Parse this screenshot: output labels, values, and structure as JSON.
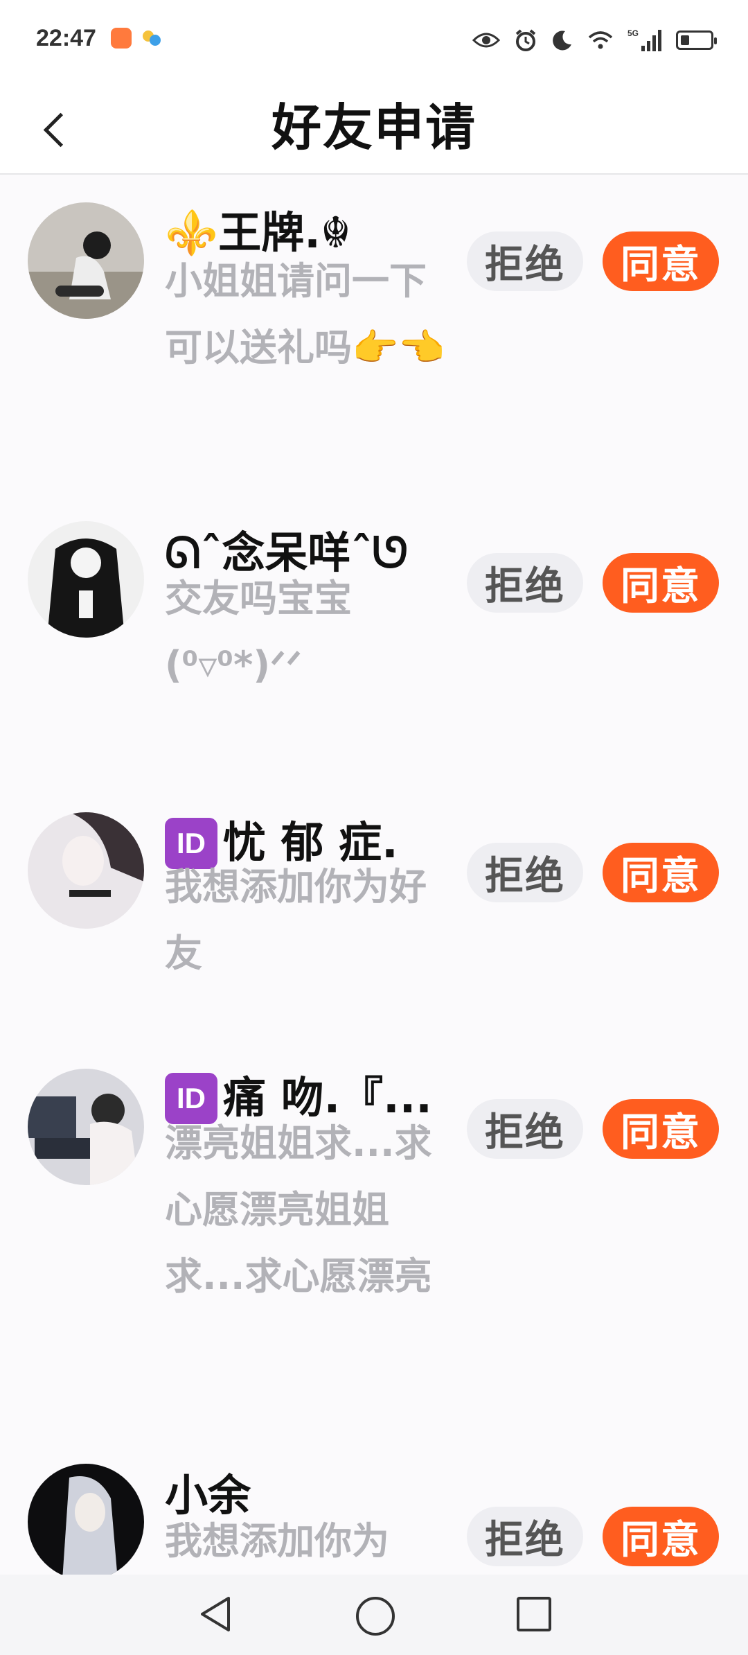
{
  "status_bar": {
    "time": "22:47",
    "icons": [
      "eye-icon",
      "alarm-icon",
      "moon-icon",
      "wifi-icon",
      "5g-signal-icon",
      "battery-icon"
    ],
    "network_label": "5G"
  },
  "header": {
    "title": "好友申请",
    "back_icon": "chevron-left-icon"
  },
  "requests": [
    {
      "nickname": "⚜️王牌.☬",
      "message": "小姐姐请问一下可以送礼吗👉👈",
      "reject_label": "拒绝",
      "accept_label": "同意"
    },
    {
      "nickname": "ᘏˆ念呆咩ˆᘎ",
      "message": "交友吗宝宝(⁰▿⁰*)ᐟᐟ",
      "reject_label": "拒绝",
      "accept_label": "同意"
    },
    {
      "badge": "ID",
      "nickname": "忧 郁 症.",
      "message": "我想添加你为好友",
      "reject_label": "拒绝",
      "accept_label": "同意"
    },
    {
      "badge": "ID",
      "nickname": "痛  吻.『...",
      "message": "漂亮姐姐求...求心愿漂亮姐姐求...求心愿漂亮",
      "reject_label": "拒绝",
      "accept_label": "同意"
    },
    {
      "nickname": "小余",
      "message": "我想添加你为",
      "reject_label": "拒绝",
      "accept_label": "同意"
    }
  ],
  "colors": {
    "accept": "#ff5d1f",
    "reject_bg": "#eeeef2",
    "message_text": "#b2b2b7",
    "id_badge": "#9b42c8"
  },
  "nav_bar": {
    "icons": [
      "back-triangle-icon",
      "home-circle-icon",
      "recent-square-icon"
    ]
  }
}
